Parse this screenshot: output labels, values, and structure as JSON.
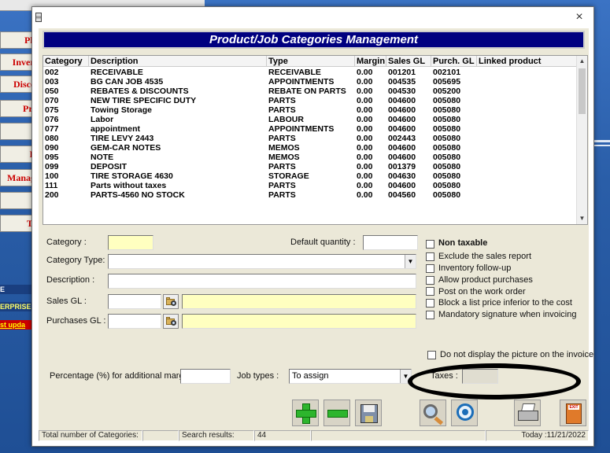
{
  "background_app": {
    "buttons": [
      "Ph",
      "Inven",
      "Disco",
      "Pri",
      "",
      "P",
      "Manag",
      "",
      "Ti"
    ],
    "labels": [
      {
        "text": "E",
        "color": "#ffffff",
        "bg": "#1a3f80"
      },
      {
        "text": "ERPRISE",
        "color": "#ffff66",
        "bg": "#1a3f80"
      },
      {
        "text": "st upda",
        "color": "#ffff00",
        "bg": "#cc0000"
      }
    ]
  },
  "dialog": {
    "title": "",
    "close_icon": "×",
    "header": "Product/Job Categories Management",
    "list": {
      "columns": [
        "Category",
        "Description",
        "Type",
        "Margin",
        "Sales GL",
        "Purch. GL",
        "Linked product"
      ],
      "rows": [
        [
          "002",
          "RECEIVABLE",
          "RECEIVABLE",
          "0.00",
          "001201",
          "002101",
          ""
        ],
        [
          "003",
          "BG CAN JOB 4535",
          "APPOINTMENTS",
          "0.00",
          "004535",
          "005695",
          ""
        ],
        [
          "050",
          "REBATES & DISCOUNTS",
          "REBATE ON PARTS",
          "0.00",
          "004530",
          "005200",
          ""
        ],
        [
          "070",
          "NEW TIRE SPECIFIC DUTY",
          "PARTS",
          "0.00",
          "004600",
          "005080",
          ""
        ],
        [
          "075",
          "Towing Storage",
          "PARTS",
          "0.00",
          "004600",
          "005080",
          ""
        ],
        [
          "076",
          "Labor",
          "LABOUR",
          "0.00",
          "004600",
          "005080",
          ""
        ],
        [
          "077",
          "appointment",
          "APPOINTMENTS",
          "0.00",
          "004600",
          "005080",
          ""
        ],
        [
          "080",
          "TIRE LEVY 2443",
          "PARTS",
          "0.00",
          "002443",
          "005080",
          ""
        ],
        [
          "090",
          "GEM-CAR NOTES",
          "MEMOS",
          "0.00",
          "004600",
          "005080",
          ""
        ],
        [
          "095",
          "NOTE",
          "MEMOS",
          "0.00",
          "004600",
          "005080",
          ""
        ],
        [
          "099",
          "DEPOSIT",
          "PARTS",
          "0.00",
          "001379",
          "005080",
          ""
        ],
        [
          "100",
          "TIRE STORAGE 4630",
          "STORAGE",
          "0.00",
          "004630",
          "005080",
          ""
        ],
        [
          "111",
          "Parts without taxes",
          "PARTS",
          "0.00",
          "004600",
          "005080",
          ""
        ],
        [
          "200",
          "PARTS-4560 NO STOCK",
          "PARTS",
          "0.00",
          "004560",
          "005080",
          ""
        ]
      ]
    },
    "form": {
      "category_label": "Category :",
      "category_value": "",
      "default_qty_label": "Default quantity :",
      "default_qty_value": "",
      "category_type_label": "Category Type:",
      "category_type_value": "",
      "description_label": "Description :",
      "description_value": "",
      "sales_gl_label": "Sales GL :",
      "sales_gl_value": "",
      "sales_gl_desc": "",
      "purchases_gl_label": "Purchases GL :",
      "purchases_gl_value": "",
      "purchases_gl_desc": "",
      "margin_label": "Percentage (%) for additional margin :",
      "margin_value": "",
      "job_types_label": "Job types :",
      "job_types_value": "To assign",
      "taxes_label": "Taxes :",
      "taxes_value": ""
    },
    "checkboxes": {
      "non_taxable": "Non taxable",
      "exclude_sales": "Exclude the sales report",
      "inventory_followup": "Inventory follow-up",
      "allow_purchases": "Allow product purchases",
      "post_work_order": "Post on the work order",
      "block_price": "Block a list price inferior to the cost",
      "mandatory_signature": "Mandatory signature when invoicing",
      "no_picture": "Do not display the picture on the invoice"
    },
    "toolbar": [
      "add-icon",
      "remove-icon",
      "save-icon",
      "search-icon",
      "view-icon",
      "print-icon",
      "exit-icon"
    ],
    "exit_sign": "EXIT",
    "status": {
      "total_label": "Total number of Categories:",
      "total_value": "",
      "search_label": "Search results:",
      "search_value": "44",
      "extra": "",
      "today": "Today :11/21/2022"
    },
    "colors": {
      "header_bg": "#000080",
      "highlight_yellow": "#ffffc0",
      "client_bg": "#ebe8d8"
    }
  }
}
